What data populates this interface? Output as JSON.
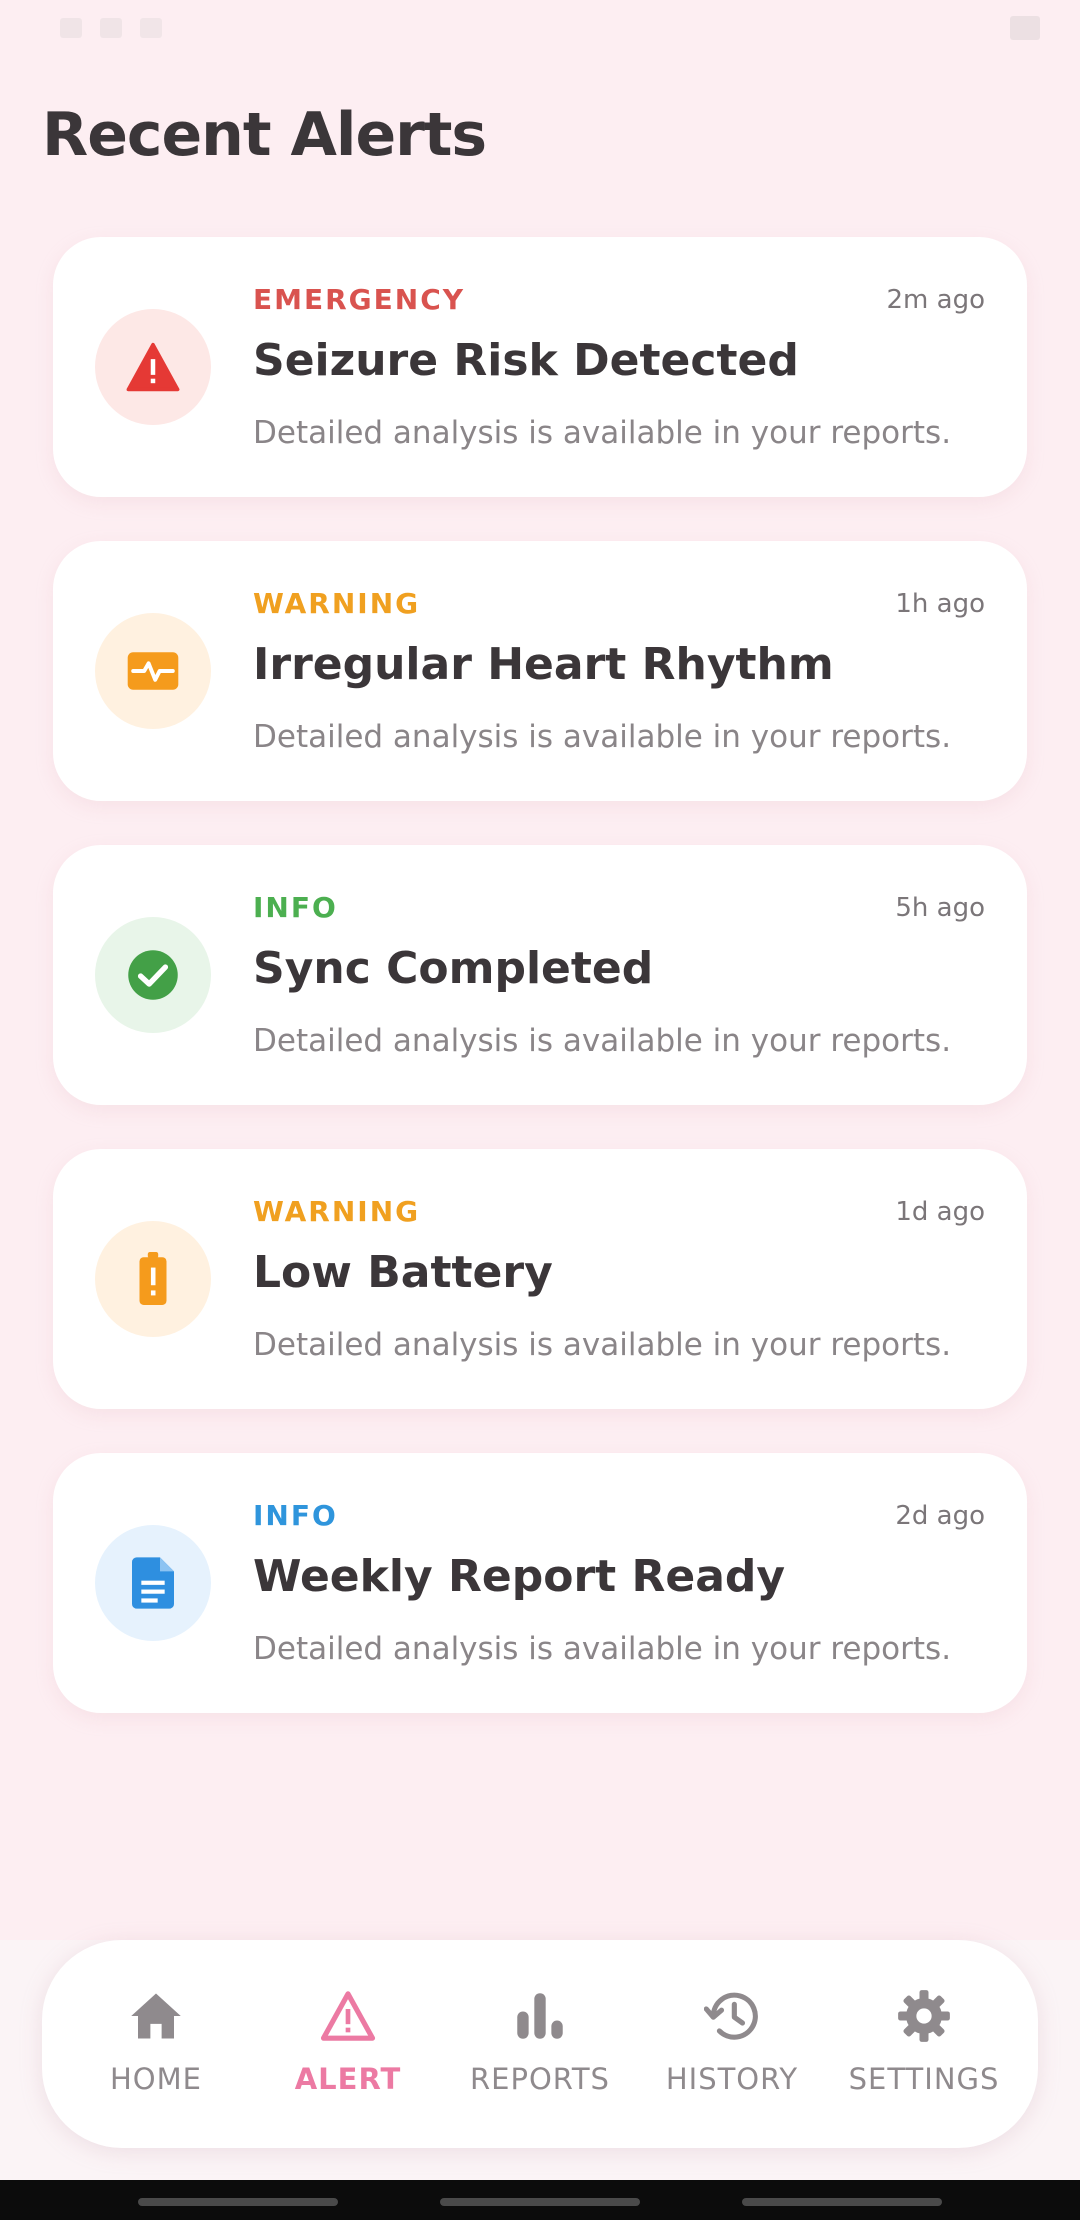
{
  "header": {
    "title": "Recent Alerts"
  },
  "alerts": [
    {
      "severity": "EMERGENCY",
      "severity_color": "#d9534f",
      "icon": "warning-triangle-icon",
      "icon_bg": "#fde8e6",
      "time": "2m ago",
      "title": "Seizure Risk Detected",
      "description": "Detailed analysis is available in your reports."
    },
    {
      "severity": "WARNING",
      "severity_color": "#f0a020",
      "icon": "heart-rhythm-icon",
      "icon_bg": "#fff1e0",
      "time": "1h ago",
      "title": "Irregular Heart Rhythm",
      "description": "Detailed analysis is available in your reports."
    },
    {
      "severity": "INFO",
      "severity_color": "#4caf50",
      "icon": "check-circle-icon",
      "icon_bg": "#e8f5e9",
      "time": "5h ago",
      "title": "Sync Completed",
      "description": "Detailed analysis is available in your reports."
    },
    {
      "severity": "WARNING",
      "severity_color": "#f0a020",
      "icon": "battery-alert-icon",
      "icon_bg": "#fff1e0",
      "time": "1d ago",
      "title": "Low Battery",
      "description": "Detailed analysis is available in your reports."
    },
    {
      "severity": "INFO",
      "severity_color": "#2f95dc",
      "icon": "document-icon",
      "icon_bg": "#e6f2fd",
      "time": "2d ago",
      "title": "Weekly Report Ready",
      "description": "Detailed analysis is available in your reports."
    }
  ],
  "nav": {
    "active": "ALERT",
    "active_color": "#ec7aa3",
    "inactive_color": "#8f8a8d",
    "items": [
      {
        "label": "HOME",
        "icon": "home-icon"
      },
      {
        "label": "ALERT",
        "icon": "alert-triangle-icon"
      },
      {
        "label": "REPORTS",
        "icon": "bar-chart-icon"
      },
      {
        "label": "HISTORY",
        "icon": "history-icon"
      },
      {
        "label": "SETTINGS",
        "icon": "gear-icon"
      }
    ]
  }
}
